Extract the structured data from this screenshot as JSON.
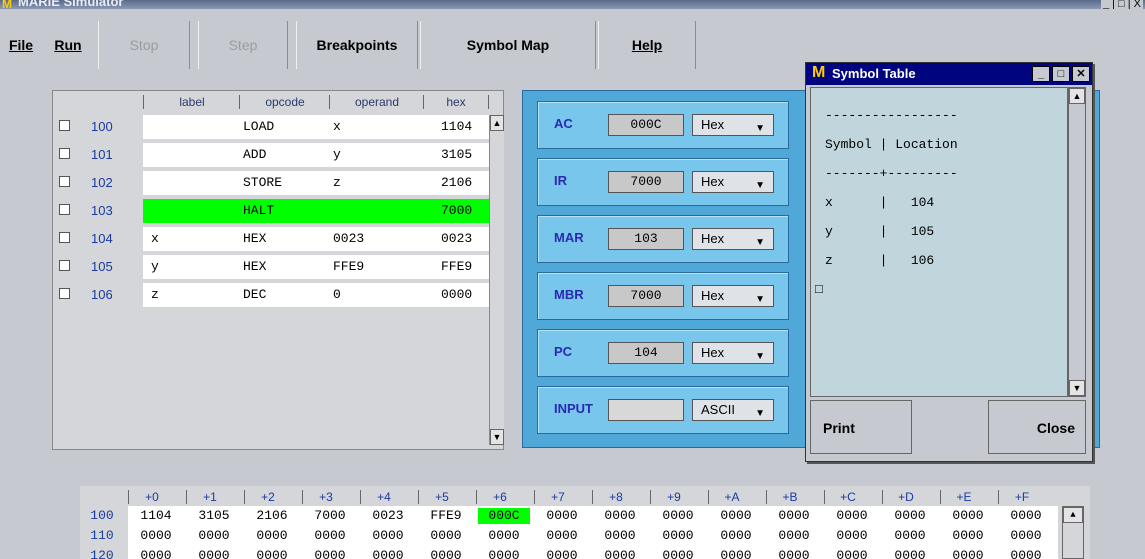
{
  "window": {
    "title": "MARIE Simulator",
    "logo": "M",
    "controls": "_ | □ | X"
  },
  "menu": {
    "file": "File",
    "run": "Run",
    "stop": "Stop",
    "step": "Step",
    "breakpoints": "Breakpoints",
    "symbol_map": "Symbol Map",
    "help": "Help"
  },
  "program": {
    "headers": {
      "label": "label",
      "opcode": "opcode",
      "operand": "operand",
      "hex": "hex"
    },
    "rows": [
      {
        "addr": "100",
        "label": "",
        "opcode": "LOAD",
        "operand": "x",
        "hex": "1104"
      },
      {
        "addr": "101",
        "label": "",
        "opcode": "ADD",
        "operand": "y",
        "hex": "3105"
      },
      {
        "addr": "102",
        "label": "",
        "opcode": "STORE",
        "operand": "z",
        "hex": "2106"
      },
      {
        "addr": "103",
        "label": "",
        "opcode": "HALT",
        "operand": "",
        "hex": "7000"
      },
      {
        "addr": "104",
        "label": "x",
        "opcode": "HEX",
        "operand": "0023",
        "hex": "0023"
      },
      {
        "addr": "105",
        "label": "y",
        "opcode": "HEX",
        "operand": "FFE9",
        "hex": "FFE9"
      },
      {
        "addr": "106",
        "label": "z",
        "opcode": "DEC",
        "operand": "0",
        "hex": "0000"
      }
    ],
    "highlight_row_index": 3
  },
  "registers": [
    {
      "name": "AC",
      "value": "000C",
      "mode": "Hex"
    },
    {
      "name": "IR",
      "value": "7000",
      "mode": "Hex"
    },
    {
      "name": "MAR",
      "value": "103",
      "mode": "Hex"
    },
    {
      "name": "MBR",
      "value": "7000",
      "mode": "Hex"
    },
    {
      "name": "PC",
      "value": "104",
      "mode": "Hex"
    },
    {
      "name": "INPUT",
      "value": "",
      "mode": "ASCII"
    }
  ],
  "symbol_table": {
    "title": "Symbol Table",
    "lines": [
      "-----------------",
      "Symbol | Location",
      "-------+---------",
      "x      |   104",
      "y      |   105",
      "z      |   106",
      "□"
    ],
    "print_label": "Print",
    "close_label": "Close"
  },
  "memory": {
    "headers": [
      "+0",
      "+1",
      "+2",
      "+3",
      "+4",
      "+5",
      "+6",
      "+7",
      "+8",
      "+9",
      "+A",
      "+B",
      "+C",
      "+D",
      "+E",
      "+F"
    ],
    "rows": [
      {
        "addr": "100",
        "cells": [
          "1104",
          "3105",
          "2106",
          "7000",
          "0023",
          "FFE9",
          "000C",
          "0000",
          "0000",
          "0000",
          "0000",
          "0000",
          "0000",
          "0000",
          "0000",
          "0000"
        ]
      },
      {
        "addr": "110",
        "cells": [
          "0000",
          "0000",
          "0000",
          "0000",
          "0000",
          "0000",
          "0000",
          "0000",
          "0000",
          "0000",
          "0000",
          "0000",
          "0000",
          "0000",
          "0000",
          "0000"
        ]
      },
      {
        "addr": "120",
        "cells": [
          "0000",
          "0000",
          "0000",
          "0000",
          "0000",
          "0000",
          "0000",
          "0000",
          "0000",
          "0000",
          "0000",
          "0000",
          "0000",
          "0000",
          "0000",
          "0000"
        ]
      }
    ],
    "highlight_cell": "100:+6"
  },
  "colors": {
    "highlight": "#00ff00",
    "register_panel": "#4fa8d8",
    "dialog_titlebar": "#00047e"
  }
}
